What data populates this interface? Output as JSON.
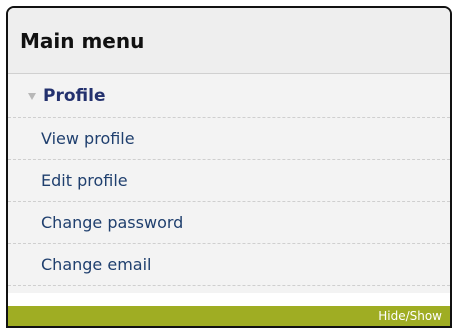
{
  "menu": {
    "title": "Main menu",
    "section": {
      "label": "Profile",
      "icon": "triangle-down-icon"
    },
    "items": [
      {
        "label": "View profile"
      },
      {
        "label": "Edit profile"
      },
      {
        "label": "Change password"
      },
      {
        "label": "Change email"
      }
    ],
    "toggle_label": "Hide/Show",
    "colors": {
      "toggle_bar": "#9fad23",
      "link": "#1f3f6e",
      "section": "#23316e"
    }
  }
}
